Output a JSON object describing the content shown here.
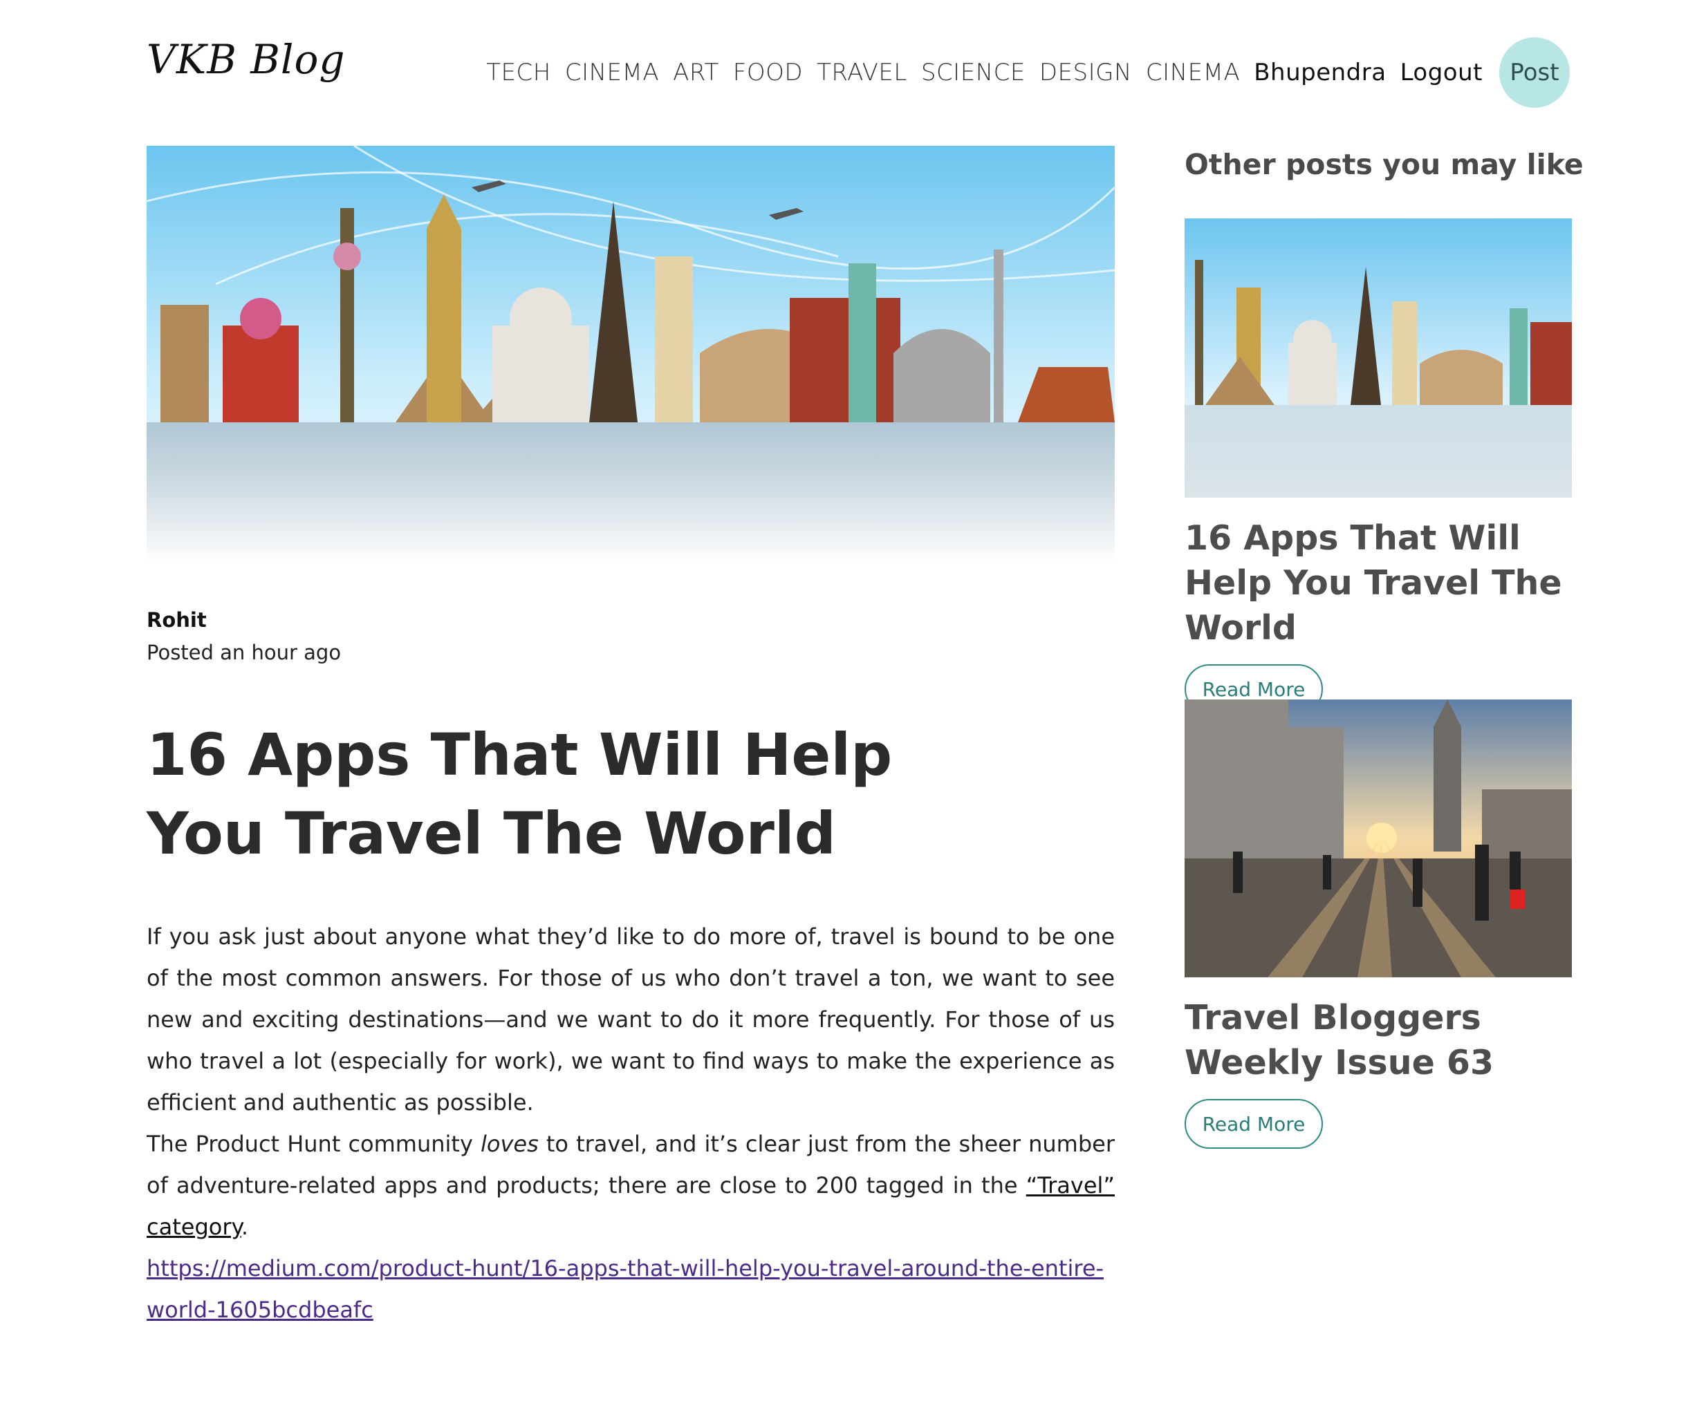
{
  "header": {
    "logo": "VKB Blog",
    "nav": [
      "TECH",
      "CINEMA",
      "ART",
      "FOOD",
      "TRAVEL",
      "SCIENCE",
      "DESIGN",
      "CINEMA"
    ],
    "user": "Bhupendra",
    "logout": "Logout",
    "post": "Post"
  },
  "article": {
    "author": "Rohit",
    "posted": "Posted an hour ago",
    "title": "16 Apps That Will Help You Travel The World",
    "para1": "If you ask just about anyone what they’d like to do more of, travel is bound to be one of the most common answers. For those of us who don’t travel a ton, we want to see new and exciting destinations—and we want to do it more frequently. For those of us who travel a lot (especially for work), we want to find ways to make the experience as efficient and authentic as possible.",
    "para2_a": "The Product Hunt community ",
    "para2_em": "loves",
    "para2_b": " to travel, and it’s clear just from the sheer number of adventure-related apps and products; there are close to 200 tagged in the ",
    "para2_link": "“Travel” category",
    "para2_end": ".",
    "url": "https://medium.com/product-hunt/16-apps-that-will-help-you-travel-around-the-entire-world-1605bcdbeafc"
  },
  "sidebar": {
    "heading": "Other posts you may like",
    "posts": [
      {
        "title": "16 Apps That Will Help You Travel The World",
        "button": "Read More"
      },
      {
        "title": "Travel Bloggers Weekly Issue 63",
        "button": "Read More"
      }
    ]
  }
}
